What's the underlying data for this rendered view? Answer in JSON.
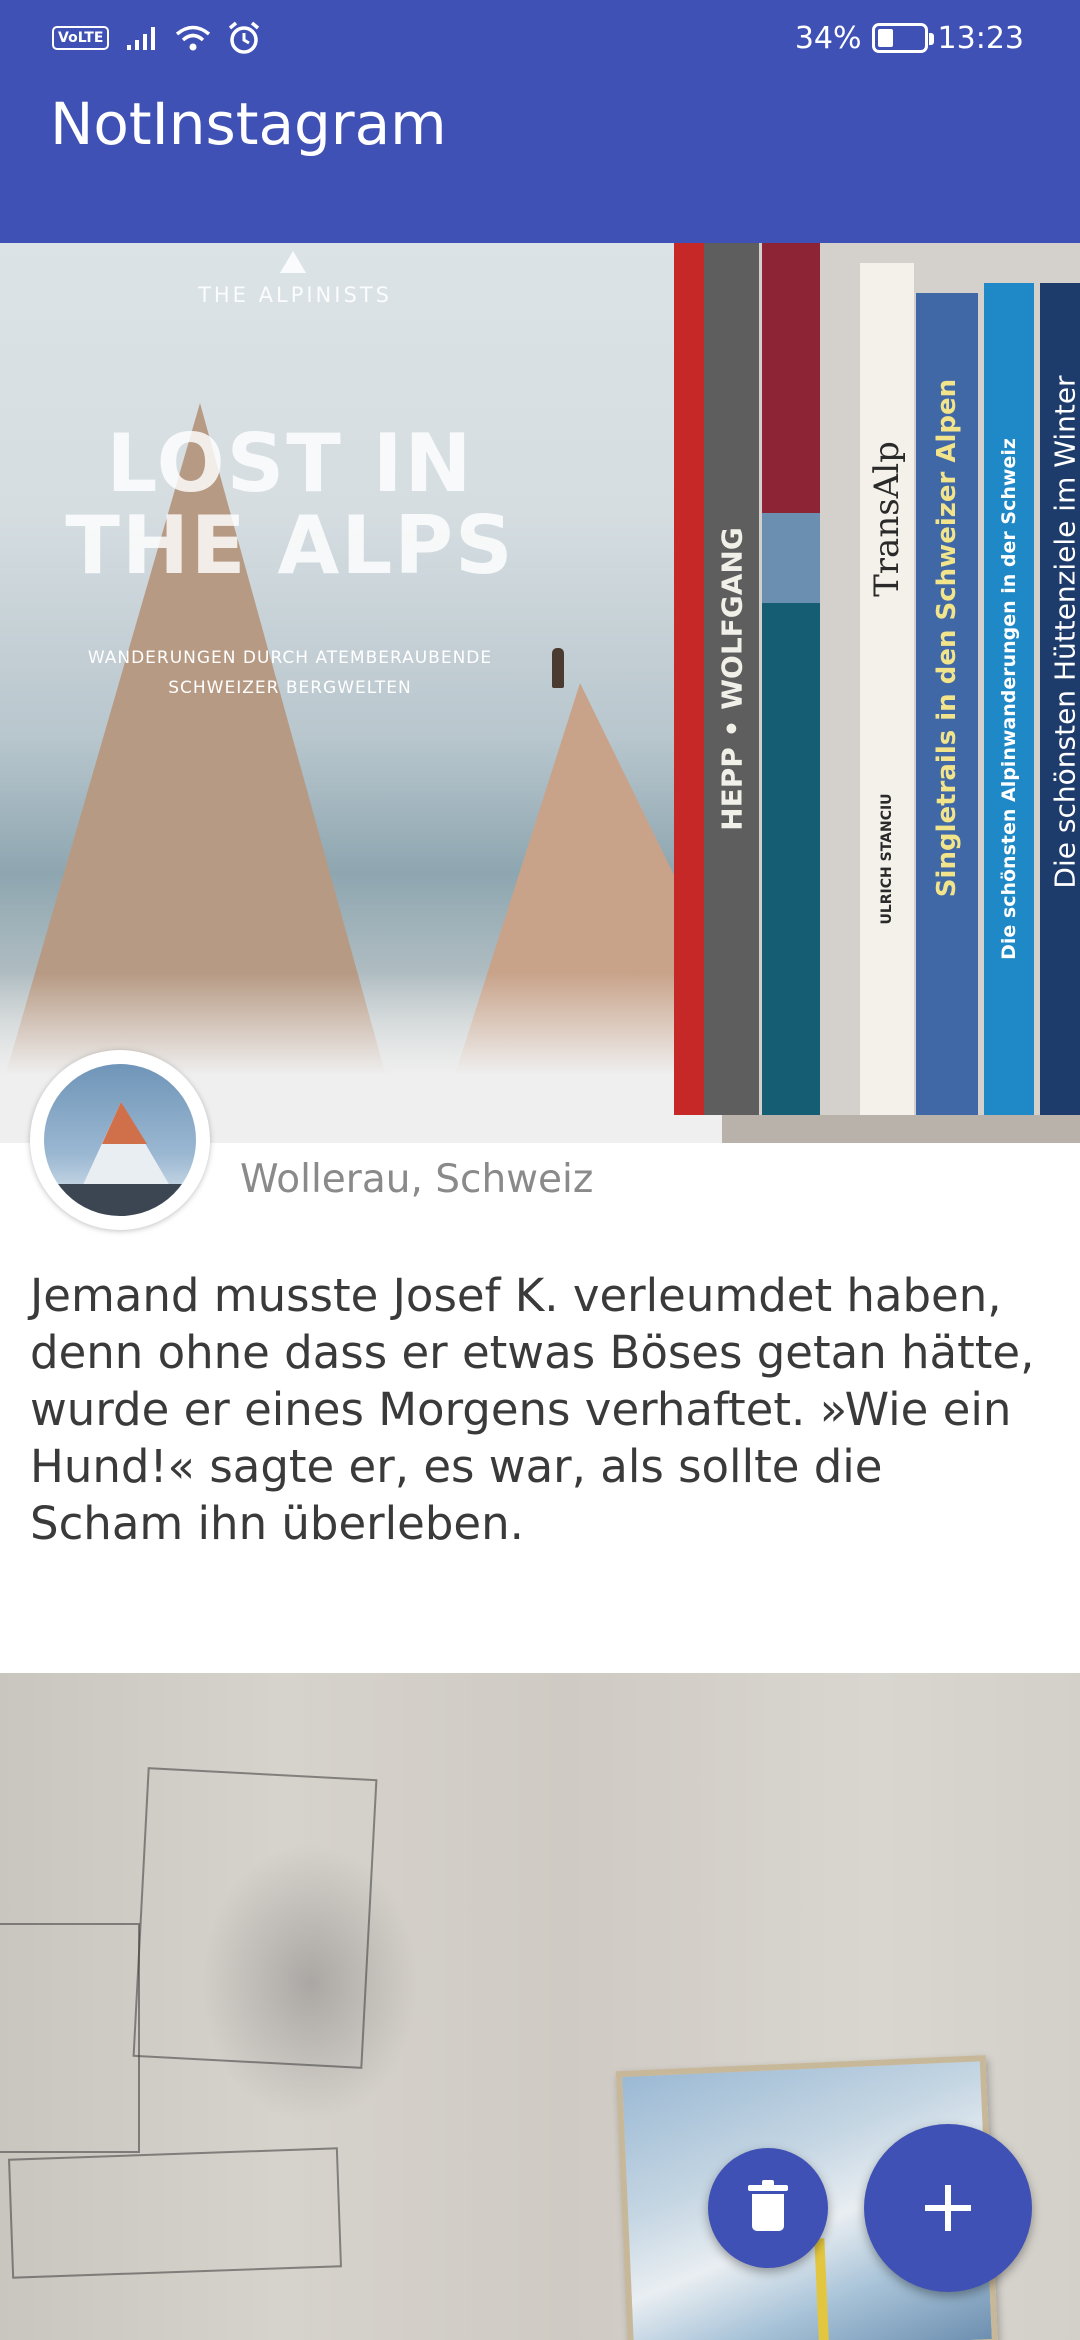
{
  "status_bar": {
    "network_badge": "VoLTE",
    "battery_percent": "34%",
    "battery_level": 0.34,
    "time": "13:23",
    "icons": [
      "volte-icon",
      "signal-icon",
      "wifi-icon",
      "alarm-icon",
      "battery-icon"
    ]
  },
  "app_bar": {
    "title": "NotInstagram",
    "color": "#3f51b5"
  },
  "posts": [
    {
      "image_text": {
        "publisher": "THE ALPINISTS",
        "title": "LOST IN\nTHE ALPS",
        "subtitle": "WANDERUNGEN DURCH ATEMBERAUBENDE\nSCHWEIZER BERGWELTEN",
        "spines": [
          "HEPP • WOLFGANG",
          "TransAlp",
          "ULRICH STANCIU",
          "Singletrails in den Schweizer Alpen",
          "Die schönsten Alpinwanderungen in der Schweiz",
          "Die schönsten Hüttenziele im Winter"
        ]
      },
      "location": "Wollerau, Schweiz",
      "caption": "Jemand musste Josef K. verleumdet haben, denn ohne dass er etwas Böses getan hätte, wurde er eines Morgens verhaftet. »Wie ein Hund!« sagte er, es war, als sollte die Scham ihn überleben."
    },
    {
      "location": "",
      "caption": ""
    }
  ],
  "fabs": {
    "delete_icon": "trash-icon",
    "add_icon": "plus-icon",
    "color": "#3f51b5"
  }
}
